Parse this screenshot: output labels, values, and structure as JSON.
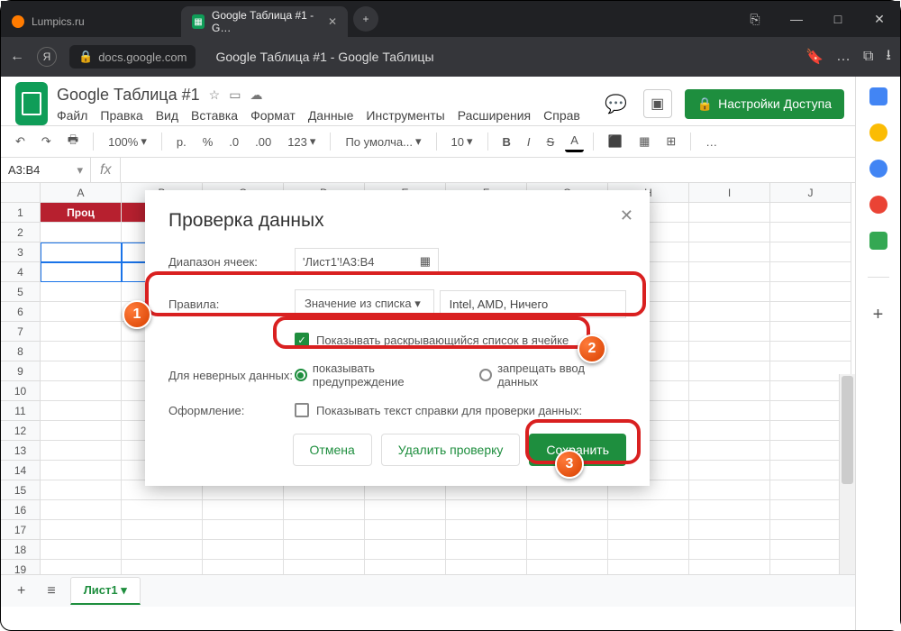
{
  "window": {
    "min": "—",
    "max": "□",
    "close": "✕",
    "hub": "⎘"
  },
  "tabs": {
    "inactive": "Lumpics.ru",
    "active": "Google Таблица #1 - G…",
    "close": "✕",
    "new": "+"
  },
  "addr": {
    "back": "←",
    "ya": "Я",
    "lock": "🔒",
    "domain": "docs.google.com",
    "title": "Google Таблица #1 - Google Таблицы",
    "bm": "🔖",
    "more": "…",
    "ext": "⧉",
    "dl": "⭳"
  },
  "header": {
    "title": "Google Таблица #1",
    "star": "☆",
    "move": "▭",
    "cloud": "☁",
    "comment": "💬",
    "present": "▣",
    "lock": "🔒",
    "share": "Настройки Доступа"
  },
  "menu": [
    "Файл",
    "Правка",
    "Вид",
    "Вставка",
    "Формат",
    "Данные",
    "Инструменты",
    "Расширения",
    "Справ"
  ],
  "toolbar": {
    "undo": "↶",
    "redo": "↷",
    "print": "🖶",
    "zoom": "100%",
    "currency": "р.",
    "percent": "%",
    "dec1": ".0",
    "dec2": ".00",
    "num": "123",
    "font": "По умолча...",
    "size": "10",
    "bold": "B",
    "italic": "I",
    "strike": "S",
    "color": "A",
    "fill": "⬛",
    "border": "▦",
    "merge": "⊞",
    "more": "…",
    "up": "∧"
  },
  "namebox": {
    "ref": "A3:B4",
    "fx": "fx"
  },
  "gridcols": [
    "",
    "A",
    "B",
    "C",
    "D",
    "E",
    "F",
    "G",
    "H",
    "I",
    "J"
  ],
  "gridrows": 21,
  "hdrcell": "Проц",
  "dialog": {
    "title": "Проверка данных",
    "close": "✕",
    "range_label": "Диапазон ячеек:",
    "range_value": "'Лист1'!A3:B4",
    "rules_label": "Правила:",
    "rules_select": "Значение из списка",
    "rules_text": "Intel, AMD, Ничего",
    "show_dd": "Показывать раскрывающийся список в ячейке",
    "invalid_label": "Для неверных данных:",
    "invalid_warn": "показывать предупреждение",
    "invalid_reject": "запрещать ввод данных",
    "appearance_label": "Оформление:",
    "help_text": "Показывать текст справки для проверки данных:",
    "cancel": "Отмена",
    "delete": "Удалить проверку",
    "save": "Сохранить"
  },
  "sheettab": {
    "add": "+",
    "all": "≡",
    "name": "Лист1",
    "dd": "▾",
    "left": "◀"
  },
  "badges": {
    "1": "1",
    "2": "2",
    "3": "3"
  }
}
